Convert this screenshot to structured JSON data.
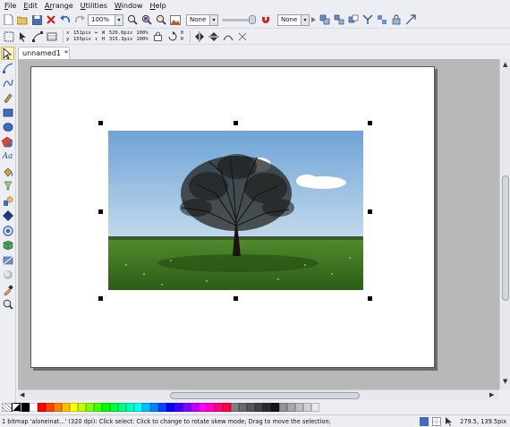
{
  "menubar": {
    "items": [
      {
        "key": "F",
        "rest": "ile"
      },
      {
        "key": "E",
        "rest": "dit"
      },
      {
        "key": "Ar",
        "rest": "range"
      },
      {
        "key": "U",
        "rest": "tilities"
      },
      {
        "key": "W",
        "rest": "indow"
      },
      {
        "key": "H",
        "rest": "elp"
      }
    ]
  },
  "toolbar": {
    "zoom_value": "100%",
    "outline_value": "None",
    "wrap_value": "None"
  },
  "properties": {
    "x": "151pix",
    "y": "155pix",
    "w": "526.6pix",
    "h": "315.3pix",
    "scale_w": "100",
    "scale_h": "100",
    "scale_unit": "%",
    "rotation": "0",
    "rotation_b": "0"
  },
  "document": {
    "tab_label": "unnamed1",
    "tab_modified_marker": "*"
  },
  "palette": {
    "colors": [
      "#000000",
      "#ffffff",
      "#ff0000",
      "#ff4000",
      "#ff8000",
      "#ffbf00",
      "#ffff00",
      "#bfff00",
      "#80ff00",
      "#40ff00",
      "#00ff00",
      "#00ff40",
      "#00ff80",
      "#00ffbf",
      "#00ffff",
      "#00bfff",
      "#0080ff",
      "#0040ff",
      "#0000ff",
      "#4000ff",
      "#8000ff",
      "#bf00ff",
      "#ff00ff",
      "#ff00bf",
      "#ff0080",
      "#ff0040",
      "#7f7f7f",
      "#6a6a6a",
      "#555555",
      "#404040",
      "#2b2b2b",
      "#161616",
      "#939393",
      "#a8a8a8",
      "#bdbdbd",
      "#d2d2d2",
      "#e7e7e7"
    ]
  },
  "status": {
    "text": "1 bitmap 'aloneinat...' (320 dpi): Click select: Click to change to rotate  skew mode; Drag to move the selection;",
    "coords": "279.5, 139.5pix"
  }
}
